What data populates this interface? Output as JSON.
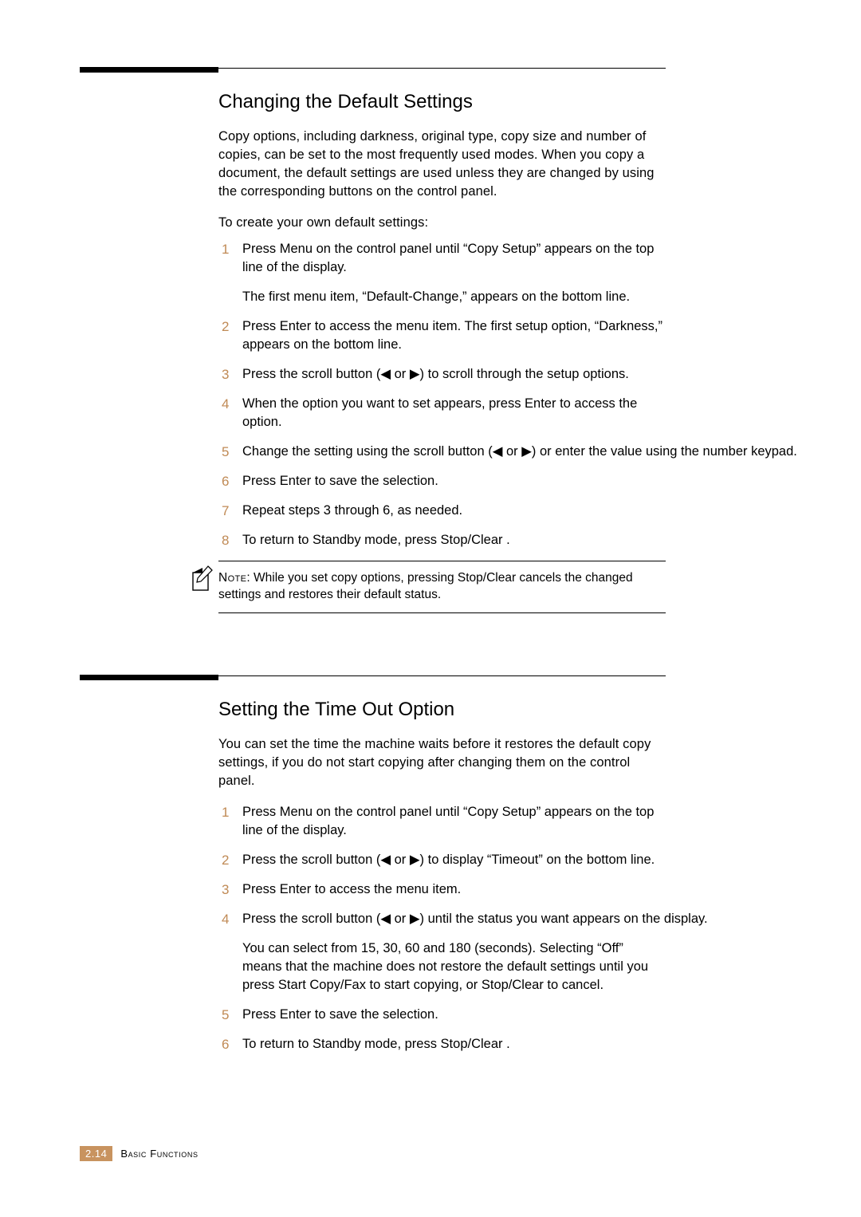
{
  "section1": {
    "heading": "Changing the Default Settings",
    "intro": "Copy options, including darkness, original type, copy size and number of copies, can be set to the most frequently used modes. When you copy a document, the default settings are used unless they are changed by using the corresponding buttons on the control panel.",
    "lead": "To create your own default settings:",
    "steps": [
      {
        "num": "1",
        "text": "Press Menu  on the control panel until “Copy Setup” appears on the top line of the display.",
        "sub": "The first menu item, “Default-Change,” appears on the bottom line."
      },
      {
        "num": "2",
        "text": "Press Enter  to access the menu item. The first setup option, “Darkness,” appears on the bottom line."
      },
      {
        "num": "3",
        "text": "Press the scroll button (◀ or ▶) to scroll through the setup options."
      },
      {
        "num": "4",
        "text": "When the option you want to set appears, press Enter  to access the option."
      },
      {
        "num": "5",
        "text": "Change the setting using the scroll button (◀ or ▶) or enter the value using the number keypad."
      },
      {
        "num": "6",
        "text": "Press Enter  to save the selection."
      },
      {
        "num": "7",
        "text": "Repeat steps 3 through 6, as needed."
      },
      {
        "num": "8",
        "text": "To return to Standby mode, press Stop/Clear   ."
      }
    ]
  },
  "note": {
    "label": "Note",
    "text": ": While you set copy options, pressing Stop/Clear     cancels the changed settings and restores their default status."
  },
  "section2": {
    "heading": "Setting the Time Out Option",
    "intro": "You can set the time the machine waits before it restores the default copy settings, if you do not start copying after changing them on the control panel.",
    "steps": [
      {
        "num": "1",
        "text": "Press Menu  on the control panel until “Copy Setup” appears on the top line of the display."
      },
      {
        "num": "2",
        "text": "Press the scroll button (◀ or ▶) to display “Timeout” on the bottom line."
      },
      {
        "num": "3",
        "text": "Press Enter  to access the menu item."
      },
      {
        "num": "4",
        "text": "Press the scroll button (◀ or ▶) until the status you want appears on the display.",
        "sub": "You can select from 15, 30, 60 and 180 (seconds). Selecting “Off” means that the machine does not restore the default settings until you press Start Copy/Fax      to start copying, or Stop/Clear     to cancel."
      },
      {
        "num": "5",
        "text": "Press Enter  to save the selection."
      },
      {
        "num": "6",
        "text": "To return to Standby mode, press Stop/Clear   ."
      }
    ]
  },
  "footer": {
    "page": "2.14",
    "label": "Basic Functions"
  }
}
